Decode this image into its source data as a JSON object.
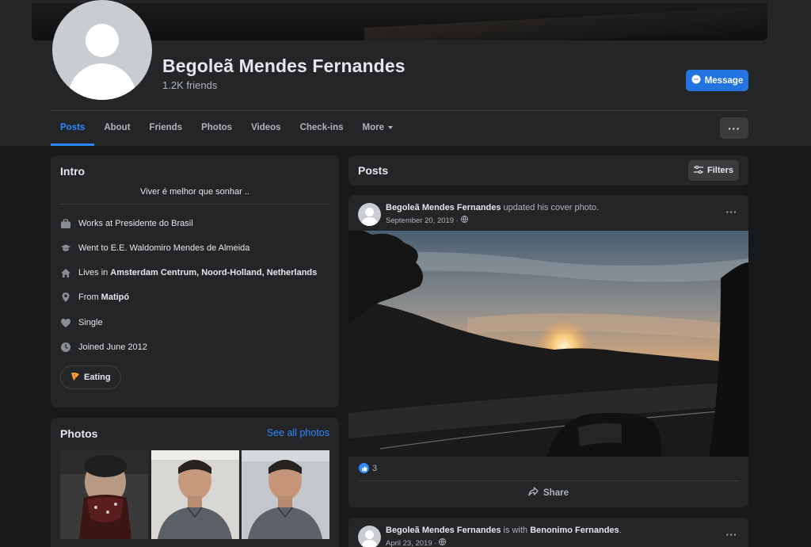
{
  "profile": {
    "name": "Begoleã Mendes Fernandes",
    "friends": "1.2K friends",
    "message_label": "Message"
  },
  "tabs": [
    {
      "label": "Posts",
      "active": true
    },
    {
      "label": "About"
    },
    {
      "label": "Friends"
    },
    {
      "label": "Photos"
    },
    {
      "label": "Videos"
    },
    {
      "label": "Check-ins"
    },
    {
      "label": "More"
    }
  ],
  "more_menu": "···",
  "intro": {
    "title": "Intro",
    "bio": "Viver é melhor que sonhar ..",
    "work": {
      "prefix": "Works at ",
      "value": "Presidente do Brasil",
      "icon": "briefcase-icon"
    },
    "education": {
      "prefix": "Went to ",
      "value": "E.E. Waldomiro Mendes de Almeida",
      "icon": "graduation-cap-icon"
    },
    "lives": {
      "prefix": "Lives in ",
      "value": "Amsterdam Centrum, Noord-Holland, Netherlands",
      "icon": "home-icon"
    },
    "from": {
      "prefix": "From ",
      "value": "Matipó",
      "icon": "location-pin-icon"
    },
    "relationship": {
      "value": "Single",
      "icon": "heart-icon"
    },
    "joined": {
      "value": "Joined June 2012",
      "icon": "clock-icon"
    },
    "hobby": {
      "value": "Eating",
      "icon": "pizza-icon"
    }
  },
  "photos": {
    "title": "Photos",
    "see_all": "See all photos"
  },
  "posts_header": {
    "title": "Posts",
    "filters_label": "Filters"
  },
  "posts": [
    {
      "author": "Begoleã Mendes Fernandes",
      "action": " updated his cover photo.",
      "date": "September 20, 2019 ·",
      "likes": "3",
      "share_label": "Share"
    },
    {
      "author": "Begoleã Mendes Fernandes",
      "action": " is with ",
      "tagged": "Benonimo Fernandes",
      "tail": ".",
      "date": "April 23, 2019 ·"
    }
  ],
  "colors": {
    "accent": "#2d88ff",
    "button": "#2374e1",
    "card": "#242526",
    "background": "#18191a"
  }
}
